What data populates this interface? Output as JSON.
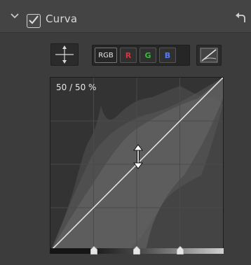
{
  "header": {
    "title": "Curva",
    "enabled": true,
    "icons": [
      "chevron-down-icon",
      "checkbox-check-icon",
      "reset-arrow-icon"
    ]
  },
  "toolbar": {
    "move_tool_icon": "move-crosshair-icon",
    "channels": [
      {
        "id": "rgb",
        "label": "RGB"
      },
      {
        "id": "r",
        "label": "R"
      },
      {
        "id": "g",
        "label": "G"
      },
      {
        "id": "b",
        "label": "B"
      }
    ],
    "curve_tool_icon": "curve-linear-icon"
  },
  "graph": {
    "readout": "50 / 50 %"
  },
  "colors": {
    "panel_bg": "#3c3c3c",
    "graph_bg": "#333333",
    "red": "#e0303a",
    "green": "#30c030",
    "blue": "#4f7cff"
  }
}
